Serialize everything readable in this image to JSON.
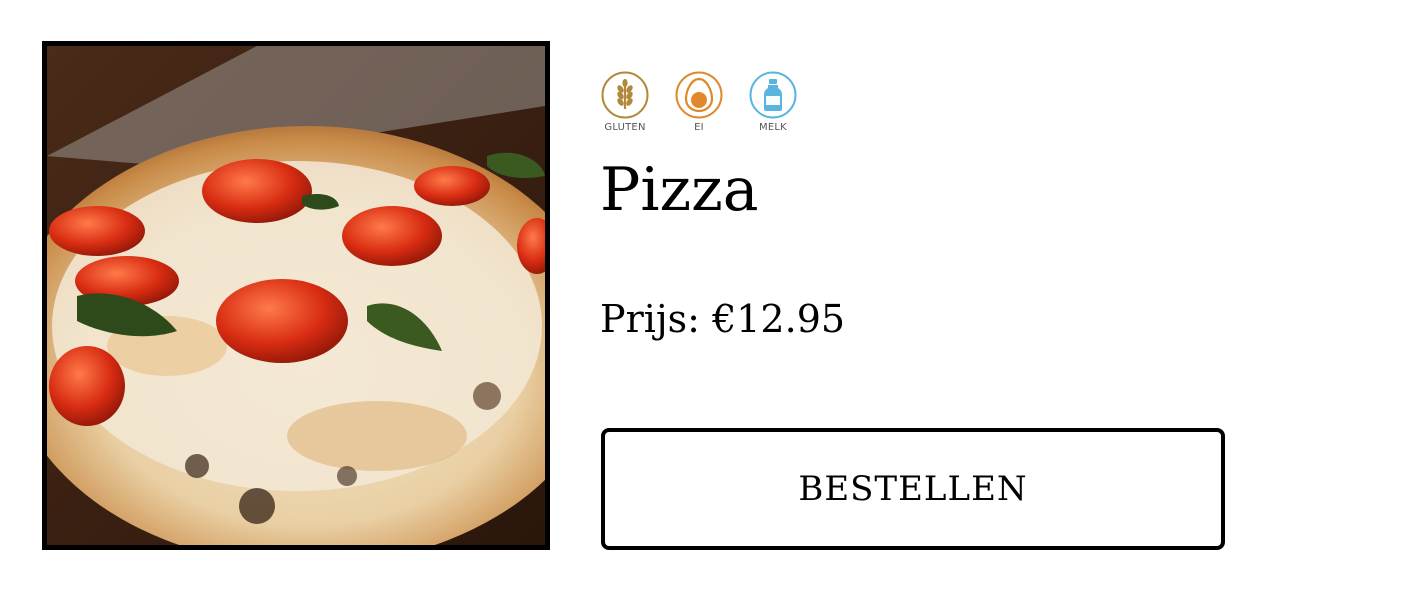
{
  "product": {
    "image_alt": "Pizza",
    "allergens": [
      {
        "label": "GLUTEN",
        "icon": "wheat-icon",
        "color": "#b0893a"
      },
      {
        "label": "EI",
        "icon": "egg-icon",
        "color": "#e0892a"
      },
      {
        "label": "MELK",
        "icon": "milk-bottle-icon",
        "color": "#5ab4e0"
      }
    ],
    "title": "Pizza",
    "price_label": "Prijs:",
    "price_value": "€12.95",
    "order_button_label": "BESTELLEN"
  }
}
